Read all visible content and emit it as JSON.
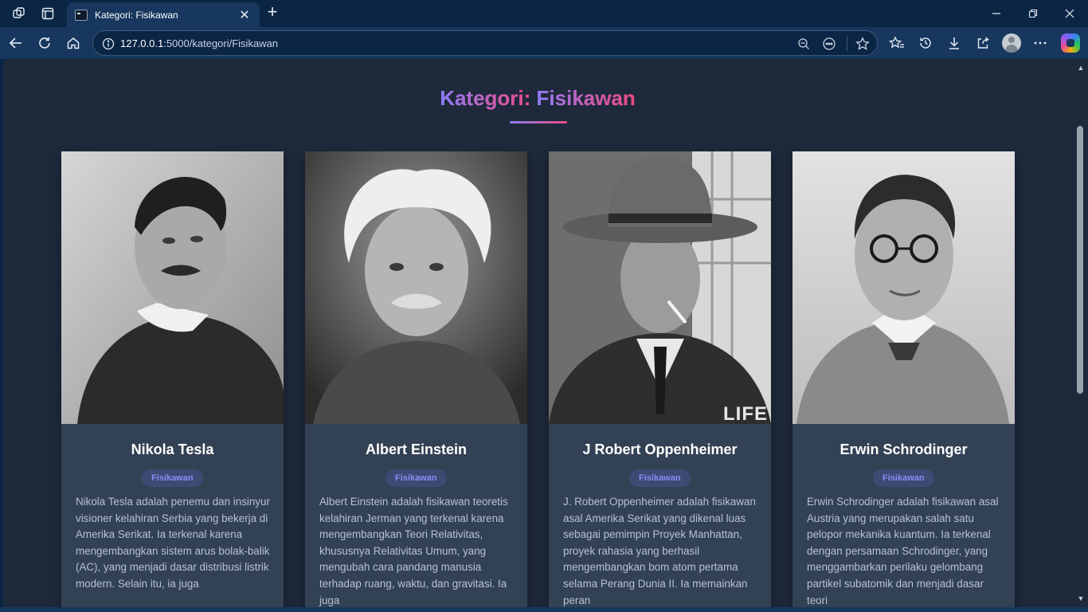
{
  "browser": {
    "tab_title": "Kategori: Fisikawan",
    "url_host": "127.0.0.1",
    "url_path": ":5000/kategori/Fisikawan",
    "tab_close_glyph": "✕",
    "new_tab_glyph": "+",
    "toolbar_icons": [
      "workspaces-icon",
      "tab-actions-icon",
      "back-icon",
      "refresh-icon",
      "home-icon",
      "site-info-icon",
      "zoom-out-icon",
      "read-aloud-icon",
      "favorite-star-icon",
      "favorites-icon",
      "history-icon",
      "downloads-icon",
      "share-icon",
      "profile-avatar",
      "more-icon",
      "copilot-icon"
    ],
    "window_controls": [
      "minimize-icon",
      "restore-icon",
      "close-icon"
    ]
  },
  "page": {
    "title_prefix": "Kategori: ",
    "title_category": "Fisikawan",
    "accent_colors": [
      "#8b7cf6",
      "#ec4a82"
    ]
  },
  "cards": [
    {
      "name": "Nikola Tesla",
      "badge": "Fisikawan",
      "description": "Nikola Tesla adalah penemu dan insinyur visioner kelahiran Serbia yang bekerja di Amerika Serikat. Ia terkenal karena mengembangkan sistem arus bolak-balik (AC), yang menjadi dasar distribusi listrik modern. Selain itu, ia juga"
    },
    {
      "name": "Albert Einstein",
      "badge": "Fisikawan",
      "description": "Albert Einstein adalah fisikawan teoretis kelahiran Jerman yang terkenal karena mengembangkan Teori Relativitas, khususnya Relativitas Umum, yang mengubah cara pandang manusia terhadap ruang, waktu, dan gravitasi. Ia juga"
    },
    {
      "name": "J Robert Oppenheimer",
      "badge": "Fisikawan",
      "description": "J. Robert Oppenheimer adalah fisikawan asal Amerika Serikat yang dikenal luas sebagai pemimpin Proyek Manhattan, proyek rahasia yang berhasil mengembangkan bom atom pertama selama Perang Dunia II. Ia memainkan peran",
      "photo_watermark": "LIFE"
    },
    {
      "name": "Erwin Schrodinger",
      "badge": "Fisikawan",
      "description": "Erwin Schrodinger adalah fisikawan asal Austria yang merupakan salah satu pelopor mekanika kuantum. Ia terkenal dengan persamaan Schrodinger, yang menggambarkan perilaku gelombang partikel subatomik dan menjadi dasar teori"
    }
  ]
}
